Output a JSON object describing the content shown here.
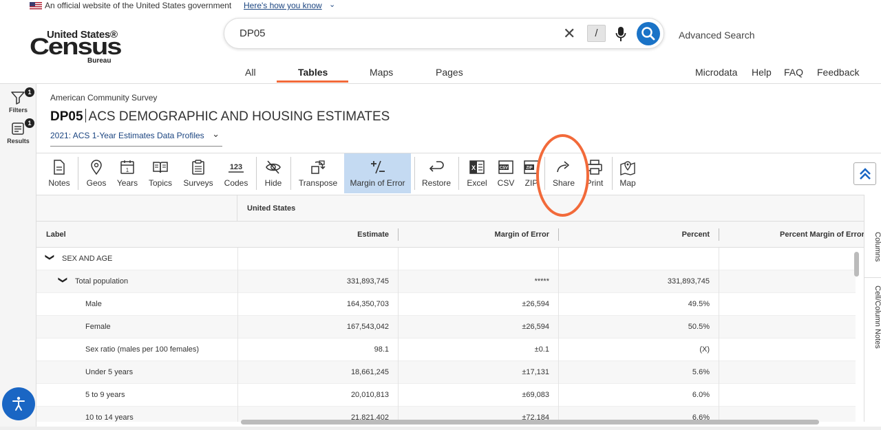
{
  "gov_banner": {
    "text": "An official website of the United States government",
    "link": "Here's how you know"
  },
  "logo": {
    "line1": "United States®",
    "line2": "Census",
    "line3": "Bureau"
  },
  "search": {
    "query": "DP05",
    "slash_key": "/",
    "advanced": "Advanced Search"
  },
  "nav": {
    "tabs": [
      "All",
      "Tables",
      "Maps",
      "Pages"
    ],
    "active_tab": "Tables",
    "right": [
      "Microdata",
      "Help",
      "FAQ",
      "Feedback"
    ]
  },
  "rail": {
    "filters": {
      "label": "Filters",
      "badge": "1"
    },
    "results": {
      "label": "Results",
      "badge": "1"
    }
  },
  "table_header": {
    "survey": "American Community Survey",
    "table_id": "DP05",
    "table_title": "ACS DEMOGRAPHIC AND HOUSING ESTIMATES",
    "vintage": "2021: ACS 1-Year Estimates Data Profiles"
  },
  "toolbar": [
    {
      "label": "Notes",
      "icon": "notes-icon"
    },
    {
      "label": "Geos",
      "icon": "map-pin-icon"
    },
    {
      "label": "Years",
      "icon": "calendar-icon"
    },
    {
      "label": "Topics",
      "icon": "book-icon"
    },
    {
      "label": "Surveys",
      "icon": "clipboard-icon"
    },
    {
      "label": "Codes",
      "icon": "codes-icon"
    },
    {
      "label": "Hide",
      "icon": "eye-off-icon"
    },
    {
      "label": "Transpose",
      "icon": "transpose-icon"
    },
    {
      "label": "Margin of Error",
      "icon": "plus-minus-icon"
    },
    {
      "label": "Restore",
      "icon": "undo-icon"
    },
    {
      "label": "Excel",
      "icon": "excel-icon"
    },
    {
      "label": "CSV",
      "icon": "csv-icon"
    },
    {
      "label": "ZIP",
      "icon": "zip-icon"
    },
    {
      "label": "Share",
      "icon": "share-icon"
    },
    {
      "label": "Print",
      "icon": "print-icon"
    },
    {
      "label": "Map",
      "icon": "map-icon"
    }
  ],
  "grid": {
    "geography": "United States",
    "columns": [
      "Label",
      "Estimate",
      "Margin of Error",
      "Percent",
      "Percent Margin of Error"
    ],
    "rows": [
      {
        "label": "SEX AND AGE",
        "estimate": "",
        "moe": "",
        "percent": "",
        "pmoe": ""
      },
      {
        "label": "Total population",
        "estimate": "331,893,745",
        "moe": "*****",
        "percent": "331,893,745",
        "pmoe": ""
      },
      {
        "label": "Male",
        "estimate": "164,350,703",
        "moe": "±26,594",
        "percent": "49.5%",
        "pmoe": ""
      },
      {
        "label": "Female",
        "estimate": "167,543,042",
        "moe": "±26,594",
        "percent": "50.5%",
        "pmoe": ""
      },
      {
        "label": "Sex ratio (males per 100 females)",
        "estimate": "98.1",
        "moe": "±0.1",
        "percent": "(X)",
        "pmoe": ""
      },
      {
        "label": "Under 5 years",
        "estimate": "18,661,245",
        "moe": "±17,131",
        "percent": "5.6%",
        "pmoe": ""
      },
      {
        "label": "5 to 9 years",
        "estimate": "20,010,813",
        "moe": "±69,083",
        "percent": "6.0%",
        "pmoe": ""
      },
      {
        "label": "10 to 14 years",
        "estimate": "21,821,402",
        "moe": "±72,184",
        "percent": "6.6%",
        "pmoe": ""
      }
    ]
  },
  "side_tabs": [
    "Columns",
    "Cell/Column Notes"
  ],
  "colors": {
    "accent": "#f26a3a",
    "link": "#1a4480",
    "primary": "#1a73c7",
    "active_tool": "#c4daf2"
  }
}
